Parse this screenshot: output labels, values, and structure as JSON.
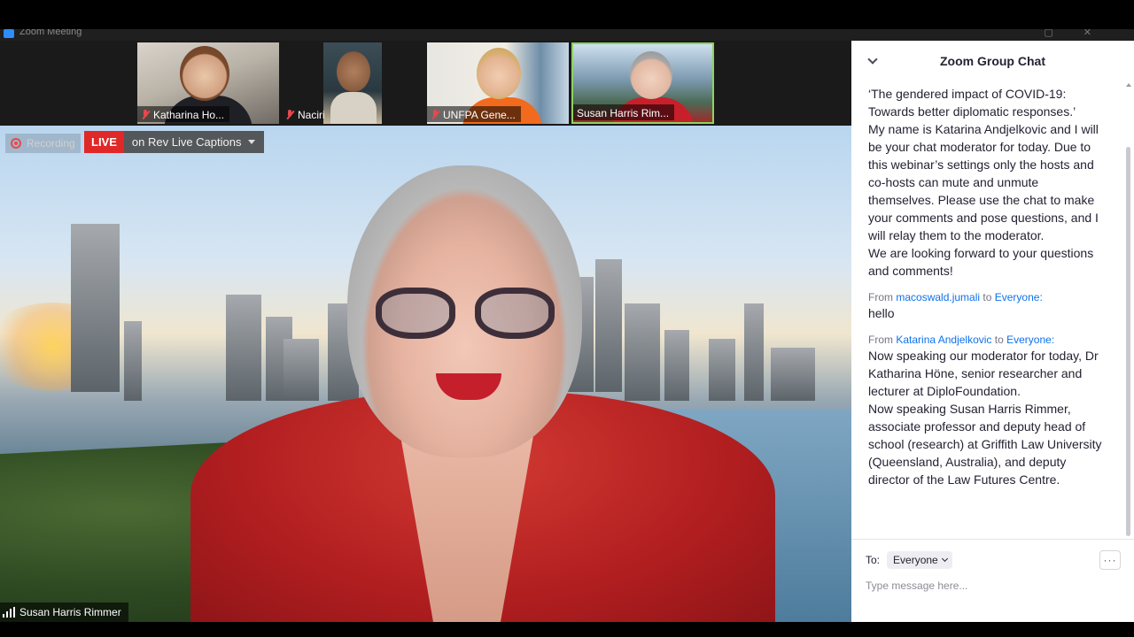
{
  "window": {
    "title": "Zoom Meeting"
  },
  "participants": [
    {
      "name": "Katharina Ho...",
      "muted": true
    },
    {
      "name": "Naciri",
      "muted": true
    },
    {
      "name": "UNFPA Gene...",
      "muted": true
    },
    {
      "name": "Susan Harris Rim...",
      "muted": false,
      "active_speaker": true
    }
  ],
  "main_video": {
    "speaker_name": "Susan Harris Rimmer",
    "recording_label": "Recording",
    "live_label": "LIVE",
    "live_stream_label": "on Rev Live Captions"
  },
  "chat": {
    "title": "Zoom Group Chat",
    "messages": [
      {
        "text": "‘The gendered impact of COVID-19: Towards better diplomatic responses.’\nMy name is Katarina Andjelkovic and I will be your chat moderator for today. Due to this webinar’s settings only the hosts and co-hosts can mute and unmute themselves. Please use the chat to make your comments and pose questions, and I will relay them to the moderator.\nWe are looking forward to your questions and comments!"
      },
      {
        "from_label": "From",
        "sender": "macoswald.jumali",
        "to_label": "to",
        "recipient": "Everyone:",
        "text": "hello"
      },
      {
        "from_label": "From",
        "sender": "Katarina Andjelkovic",
        "to_label": "to",
        "recipient": "Everyone:",
        "text": "Now speaking our moderator for today, Dr Katharina Höne, senior researcher and lecturer at DiploFoundation.\nNow speaking Susan Harris Rimmer, associate professor and deputy head of school (research) at Griffith Law University (Queensland, Australia), and deputy director of the Law Futures Centre."
      }
    ],
    "to_label": "To:",
    "recipient_select": "Everyone",
    "more_label": "···",
    "input_placeholder": "Type message here..."
  },
  "colors": {
    "accent_blue": "#0e71eb",
    "live_red": "#e02828",
    "active_speaker_border": "#8dd35f",
    "muted_red": "#e8484b"
  },
  "icons": [
    "zoom-app-icon",
    "mic-off-icon",
    "recording-icon",
    "caret-down-icon",
    "signal-bars-icon",
    "chevron-down-icon",
    "more-icon"
  ]
}
